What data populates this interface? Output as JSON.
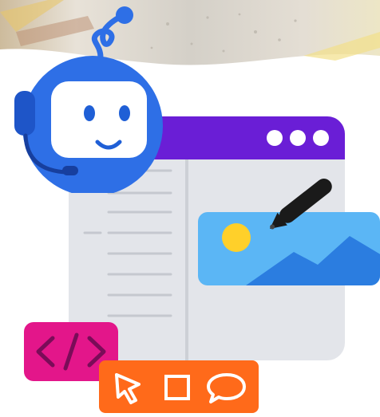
{
  "illustration": {
    "colors": {
      "robot_blue": "#2E6FE6",
      "robot_face": "#FFFFFF",
      "robot_eye": "#1F5FD6",
      "browser_header": "#6A1ED6",
      "browser_body": "#E3E5EA",
      "browser_lines": "#C8CBD2",
      "image_card": "#5BB6F5",
      "mountain": "#2B7DE0",
      "sun": "#FFD02A",
      "pen": "#1A1A1A",
      "code_badge": "#E3168A",
      "tool_bar": "#FF6A1A",
      "photo_tint": "#D9D4CC"
    },
    "icons": [
      "robot-mascot-icon",
      "headset-icon",
      "browser-window-icon",
      "window-dots-icon",
      "image-icon",
      "pen-icon",
      "code-brackets-icon",
      "cursor-arrow-icon",
      "square-shape-icon",
      "speech-bubble-icon"
    ]
  }
}
